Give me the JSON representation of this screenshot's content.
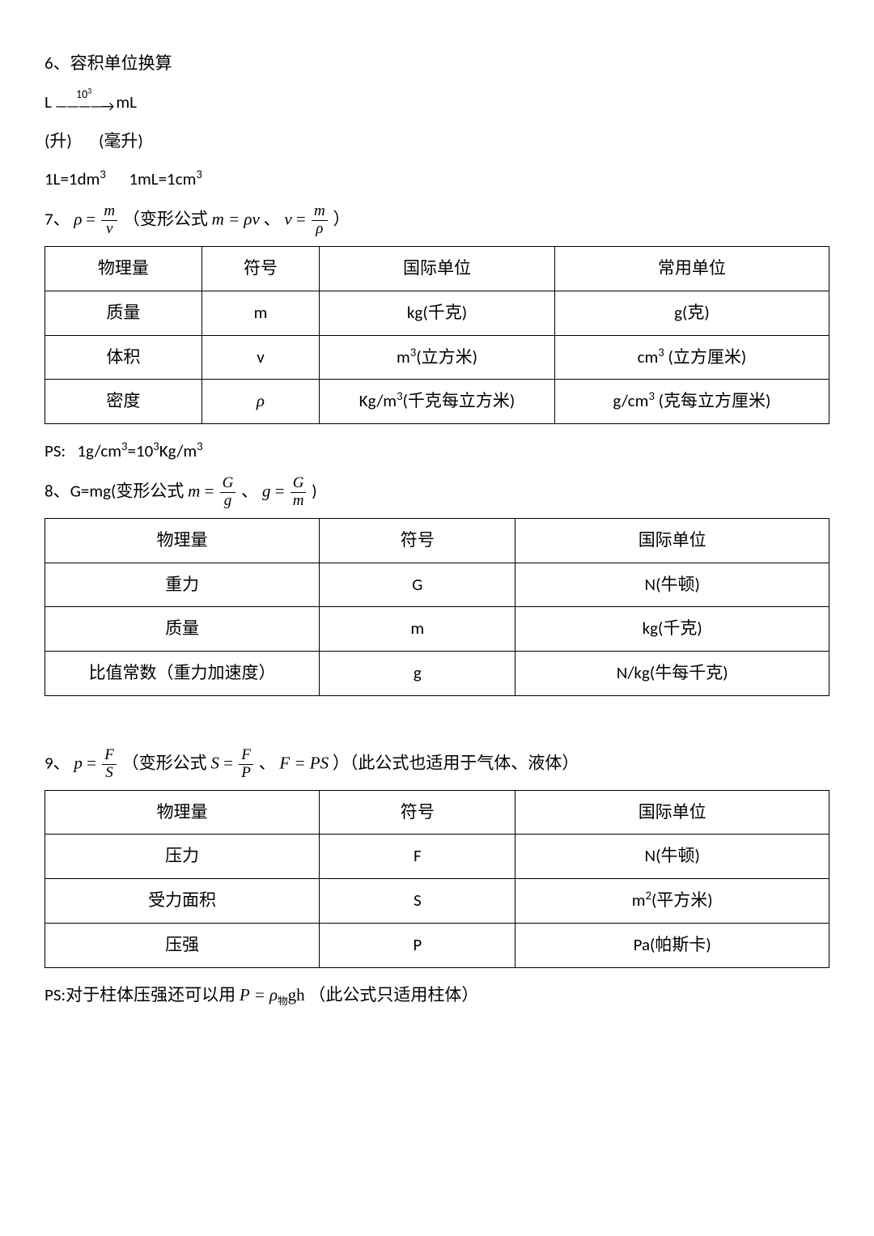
{
  "s6": {
    "title": "6、容积单位换算",
    "L": "L",
    "exp": "10",
    "exp_sup": "3",
    "mL": "mL",
    "labelL": "(升)",
    "labelmL": "(毫升)",
    "eq1": "1L=1dm",
    "eq1_sup": "3",
    "eq2": "1mL=1cm",
    "eq2_sup": "3"
  },
  "s7": {
    "prefix": "7、",
    "rho": "ρ",
    "eq_mid": " = ",
    "m": "m",
    "v": "v",
    "paren_open": "（变形公式",
    "alt1_lhs": "m",
    "alt1_rhs": " = ρv",
    "sep": "、",
    "alt2_lhs": "v",
    "alt2_num": "m",
    "alt2_den": "ρ",
    "paren_close": "）",
    "table": {
      "h1": "物理量",
      "h2": "符号",
      "h3": "国际单位",
      "h4": "常用单位",
      "r1c1": "质量",
      "r1c2": "m",
      "r1c3": "kg(千克)",
      "r1c4": "g(克)",
      "r2c1": "体积",
      "r2c2": "v",
      "r2c3_a": "m",
      "r2c3_sup": "3",
      "r2c3_b": "(立方米)",
      "r2c4_a": "cm",
      "r2c4_sup": "3",
      "r2c4_b": " (立方厘米)",
      "r3c1": "密度",
      "r3c2": "ρ",
      "r3c3_a": "Kg/m",
      "r3c3_sup": "3",
      "r3c3_b": "(千克每立方米)",
      "r3c4_a": "g/cm",
      "r3c4_sup": "3",
      "r3c4_b": " (克每立方厘米)"
    },
    "ps_a": "PS:   1g/cm",
    "ps_sup1": "3",
    "ps_b": "=10",
    "ps_sup2": "3",
    "ps_c": "Kg/m",
    "ps_sup3": "3"
  },
  "s8": {
    "prefix": "8、G=mg(变形公式",
    "f1_lhs": "m",
    "f1_num": "G",
    "f1_den": "g",
    "sep": "、",
    "f2_lhs": "g",
    "f2_num": "G",
    "f2_den": "m",
    "suffix": ")",
    "table": {
      "h1": "物理量",
      "h2": "符号",
      "h3": "国际单位",
      "r1c1": "重力",
      "r1c2": "G",
      "r1c3": "N(牛顿)",
      "r2c1": "质量",
      "r2c2": "m",
      "r2c3": "kg(千克)",
      "r3c1": "比值常数（重力加速度）",
      "r3c2": "g",
      "r3c3": "N/kg(牛每千克)"
    }
  },
  "s9": {
    "prefix": "9、",
    "f0_lhs": "p",
    "f0_num": "F",
    "f0_den": "S",
    "paren_open": "（变形公式",
    "f1_lhs": "S",
    "f1_num": "F",
    "f1_den": "P",
    "sep": "、",
    "alt2": "F = PS",
    "paren_close": "）（此公式也适用于气体、液体）",
    "table": {
      "h1": "物理量",
      "h2": "符号",
      "h3": "国际单位",
      "r1c1": "压力",
      "r1c2": "F",
      "r1c3": "N(牛顿)",
      "r2c1": "受力面积",
      "r2c2": "S",
      "r2c3_a": "m",
      "r2c3_sup": "2",
      "r2c3_b": "(平方米)",
      "r3c1": "压强",
      "r3c2": "P",
      "r3c3": "Pa(帕斯卡)"
    },
    "ps_a": "PS:对于柱体压强还可以用",
    "ps_b": "P = ρ",
    "ps_sub": "物",
    "ps_c": "gh",
    "ps_d": "（此公式只适用柱体）"
  }
}
